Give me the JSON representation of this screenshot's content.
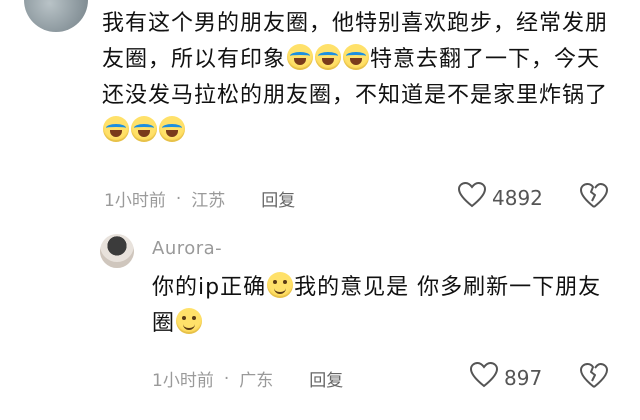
{
  "comment": {
    "segments": [
      {
        "t": "我有这个男的朋友圈，他特别喜欢跑步，经常发朋友圈，所以有印象"
      },
      {
        "e": "cry"
      },
      {
        "e": "cry"
      },
      {
        "e": "cry"
      },
      {
        "t": "特意去翻了一下，今天还没发马拉松的朋友圈，不知道是不是家里炸锅了"
      },
      {
        "e": "cry"
      },
      {
        "e": "cry"
      },
      {
        "e": "cry"
      }
    ],
    "time": "1小时前",
    "location": "江苏",
    "reply_label": "回复",
    "likes": "4892"
  },
  "reply": {
    "username": "Aurora-",
    "segments": [
      {
        "t": "你的ip正确"
      },
      {
        "e": "smile"
      },
      {
        "t": "我的意见是 你多刷新一下朋友圈"
      },
      {
        "e": "smile"
      }
    ],
    "time": "1小时前",
    "location": "广东",
    "reply_label": "回复",
    "likes": "897"
  },
  "meta_separator": "·",
  "icons": {
    "emoji_cry": "cry-laugh-emoji",
    "emoji_smile": "grin-emoji",
    "like": "heart-outline-icon",
    "dislike": "broken-heart-icon"
  },
  "colors": {
    "meta_text": "#9a9a9a",
    "body_text": "#111111",
    "emoji_yellow": "#ffe16a"
  }
}
